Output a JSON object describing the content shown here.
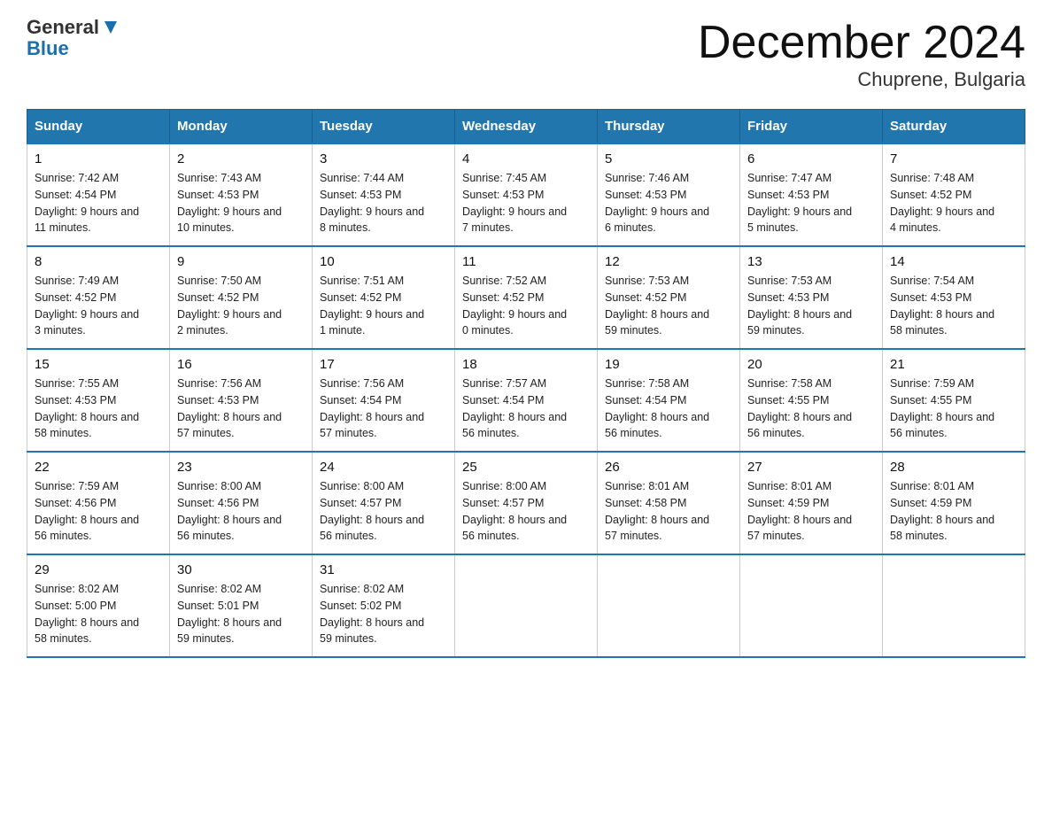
{
  "header": {
    "logo_line1": "General",
    "logo_line2": "Blue",
    "title": "December 2024",
    "subtitle": "Chuprene, Bulgaria"
  },
  "columns": [
    "Sunday",
    "Monday",
    "Tuesday",
    "Wednesday",
    "Thursday",
    "Friday",
    "Saturday"
  ],
  "weeks": [
    [
      {
        "day": "1",
        "sunrise": "7:42 AM",
        "sunset": "4:54 PM",
        "daylight": "9 hours and 11 minutes."
      },
      {
        "day": "2",
        "sunrise": "7:43 AM",
        "sunset": "4:53 PM",
        "daylight": "9 hours and 10 minutes."
      },
      {
        "day": "3",
        "sunrise": "7:44 AM",
        "sunset": "4:53 PM",
        "daylight": "9 hours and 8 minutes."
      },
      {
        "day": "4",
        "sunrise": "7:45 AM",
        "sunset": "4:53 PM",
        "daylight": "9 hours and 7 minutes."
      },
      {
        "day": "5",
        "sunrise": "7:46 AM",
        "sunset": "4:53 PM",
        "daylight": "9 hours and 6 minutes."
      },
      {
        "day": "6",
        "sunrise": "7:47 AM",
        "sunset": "4:53 PM",
        "daylight": "9 hours and 5 minutes."
      },
      {
        "day": "7",
        "sunrise": "7:48 AM",
        "sunset": "4:52 PM",
        "daylight": "9 hours and 4 minutes."
      }
    ],
    [
      {
        "day": "8",
        "sunrise": "7:49 AM",
        "sunset": "4:52 PM",
        "daylight": "9 hours and 3 minutes."
      },
      {
        "day": "9",
        "sunrise": "7:50 AM",
        "sunset": "4:52 PM",
        "daylight": "9 hours and 2 minutes."
      },
      {
        "day": "10",
        "sunrise": "7:51 AM",
        "sunset": "4:52 PM",
        "daylight": "9 hours and 1 minute."
      },
      {
        "day": "11",
        "sunrise": "7:52 AM",
        "sunset": "4:52 PM",
        "daylight": "9 hours and 0 minutes."
      },
      {
        "day": "12",
        "sunrise": "7:53 AM",
        "sunset": "4:52 PM",
        "daylight": "8 hours and 59 minutes."
      },
      {
        "day": "13",
        "sunrise": "7:53 AM",
        "sunset": "4:53 PM",
        "daylight": "8 hours and 59 minutes."
      },
      {
        "day": "14",
        "sunrise": "7:54 AM",
        "sunset": "4:53 PM",
        "daylight": "8 hours and 58 minutes."
      }
    ],
    [
      {
        "day": "15",
        "sunrise": "7:55 AM",
        "sunset": "4:53 PM",
        "daylight": "8 hours and 58 minutes."
      },
      {
        "day": "16",
        "sunrise": "7:56 AM",
        "sunset": "4:53 PM",
        "daylight": "8 hours and 57 minutes."
      },
      {
        "day": "17",
        "sunrise": "7:56 AM",
        "sunset": "4:54 PM",
        "daylight": "8 hours and 57 minutes."
      },
      {
        "day": "18",
        "sunrise": "7:57 AM",
        "sunset": "4:54 PM",
        "daylight": "8 hours and 56 minutes."
      },
      {
        "day": "19",
        "sunrise": "7:58 AM",
        "sunset": "4:54 PM",
        "daylight": "8 hours and 56 minutes."
      },
      {
        "day": "20",
        "sunrise": "7:58 AM",
        "sunset": "4:55 PM",
        "daylight": "8 hours and 56 minutes."
      },
      {
        "day": "21",
        "sunrise": "7:59 AM",
        "sunset": "4:55 PM",
        "daylight": "8 hours and 56 minutes."
      }
    ],
    [
      {
        "day": "22",
        "sunrise": "7:59 AM",
        "sunset": "4:56 PM",
        "daylight": "8 hours and 56 minutes."
      },
      {
        "day": "23",
        "sunrise": "8:00 AM",
        "sunset": "4:56 PM",
        "daylight": "8 hours and 56 minutes."
      },
      {
        "day": "24",
        "sunrise": "8:00 AM",
        "sunset": "4:57 PM",
        "daylight": "8 hours and 56 minutes."
      },
      {
        "day": "25",
        "sunrise": "8:00 AM",
        "sunset": "4:57 PM",
        "daylight": "8 hours and 56 minutes."
      },
      {
        "day": "26",
        "sunrise": "8:01 AM",
        "sunset": "4:58 PM",
        "daylight": "8 hours and 57 minutes."
      },
      {
        "day": "27",
        "sunrise": "8:01 AM",
        "sunset": "4:59 PM",
        "daylight": "8 hours and 57 minutes."
      },
      {
        "day": "28",
        "sunrise": "8:01 AM",
        "sunset": "4:59 PM",
        "daylight": "8 hours and 58 minutes."
      }
    ],
    [
      {
        "day": "29",
        "sunrise": "8:02 AM",
        "sunset": "5:00 PM",
        "daylight": "8 hours and 58 minutes."
      },
      {
        "day": "30",
        "sunrise": "8:02 AM",
        "sunset": "5:01 PM",
        "daylight": "8 hours and 59 minutes."
      },
      {
        "day": "31",
        "sunrise": "8:02 AM",
        "sunset": "5:02 PM",
        "daylight": "8 hours and 59 minutes."
      },
      null,
      null,
      null,
      null
    ]
  ],
  "labels": {
    "sunrise": "Sunrise:",
    "sunset": "Sunset:",
    "daylight": "Daylight:"
  }
}
